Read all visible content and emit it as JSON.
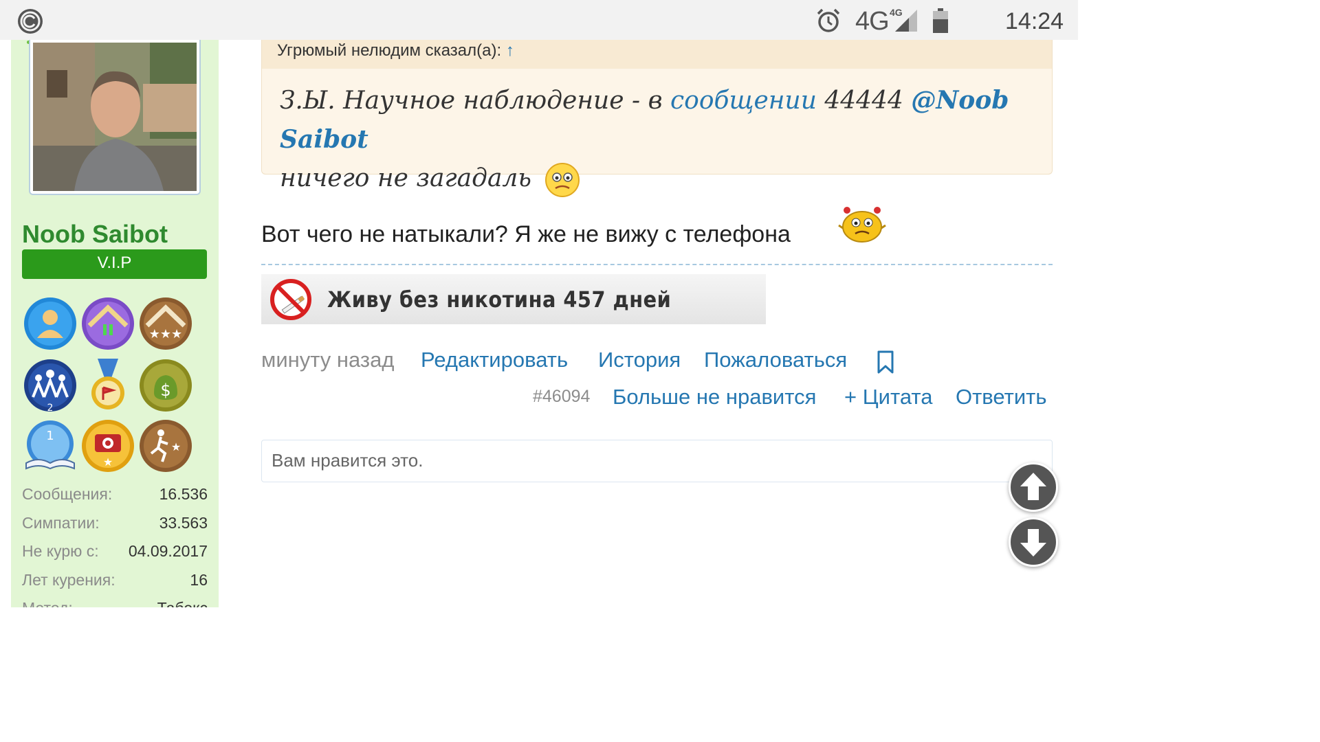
{
  "status_bar": {
    "network": "4G",
    "network_sup": "4G",
    "time": "14:24"
  },
  "sidebar": {
    "username": "Noob Saibot",
    "badge": "V.I.P",
    "trophies": [
      "trophy-user-icon",
      "trophy-level-2-icon",
      "trophy-three-stars-icon",
      "trophy-group-2-icon",
      "trophy-medal-icon",
      "trophy-money-icon",
      "trophy-book-icon",
      "trophy-camera-icon",
      "trophy-runner-icon"
    ],
    "stats": [
      {
        "label": "Сообщения:",
        "value": "16.536"
      },
      {
        "label": "Симпатии:",
        "value": "33.563"
      },
      {
        "label": "Не курю с:",
        "value": "04.09.2017"
      },
      {
        "label": "Лет курения:",
        "value": "16"
      },
      {
        "label": "Метод:",
        "value": "Табекс"
      }
    ]
  },
  "quote": {
    "author": "Угрюмый нелюдим сказал(а):",
    "arrow": "↑",
    "text_1": "З.Ы. Научное наблюдение - в ",
    "link": "сообщении",
    "text_2": " 44444 ",
    "mention": "@Noob Saibot",
    "text_3": "ничего не загадаль"
  },
  "post": {
    "message": "Вот чего не натыкали? Я же не вижу с телефона",
    "signature": "Живу без никотина 457 дней",
    "time": "минуту назад",
    "edit": "Редактировать",
    "history": "История",
    "report": "Пожаловаться",
    "post_id": "#46094",
    "unlike": "Больше не нравится",
    "quote": "+ Цитата",
    "reply": "Ответить"
  },
  "likes": {
    "text": "Вам нравится это."
  },
  "colors": {
    "link": "#2577b1",
    "sidebar_bg": "#e2f6d4",
    "username": "#2f8a2f",
    "badge_bg": "#2b9a1b",
    "quote_bg": "#fdf5e8",
    "quote_head_bg": "#f8ead3"
  }
}
